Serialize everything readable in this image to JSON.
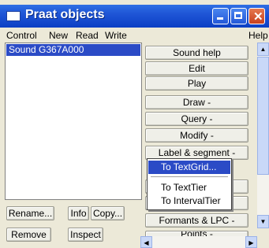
{
  "window": {
    "title": "Praat objects"
  },
  "menubar": {
    "items": [
      "Control",
      "New",
      "Read",
      "Write"
    ],
    "help": "Help"
  },
  "objects_list": {
    "items": [
      "Sound G367A000"
    ]
  },
  "left_buttons": {
    "rename": "Rename...",
    "info": "Info",
    "copy": "Copy...",
    "remove": "Remove",
    "inspect": "Inspect"
  },
  "dynamic_buttons": {
    "sound_help": "Sound help",
    "edit": "Edit",
    "play": "Play",
    "draw": "Draw -",
    "query": "Query -",
    "modify": "Modify -",
    "label_segment": "Label & segment -",
    "formants_lpc": "Formants & LPC -",
    "points": "Points -"
  },
  "popup_menu": {
    "to_textgrid": "To TextGrid...",
    "to_texttier": "To TextTier",
    "to_intervaltier": "To IntervalTier"
  },
  "colors": {
    "titlebar": "#1f55d6",
    "selection": "#2b4bc6",
    "background": "#ece9d8"
  }
}
